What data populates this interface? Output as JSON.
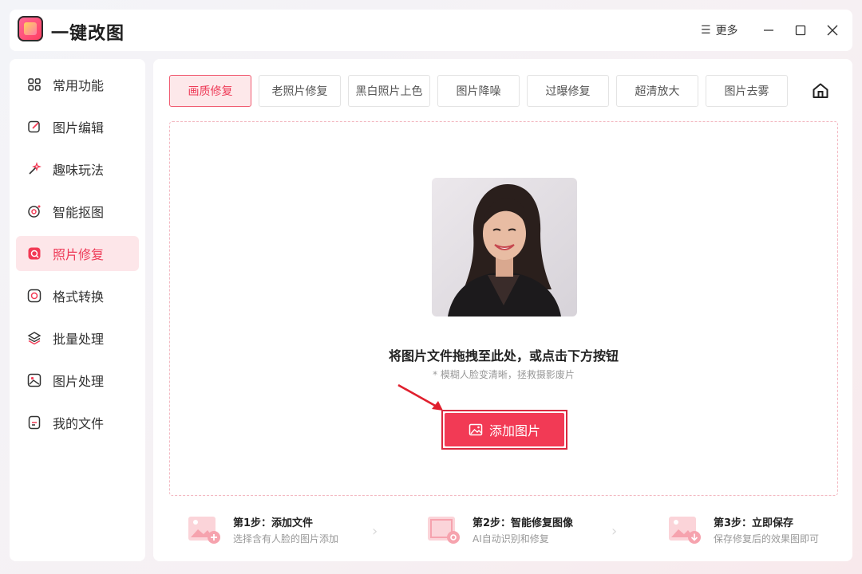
{
  "app": {
    "title": "一键改图"
  },
  "titlebar": {
    "more_label": "更多",
    "more_icon": "menu-icon",
    "minimize": "minimize-icon",
    "maximize": "maximize-icon",
    "close": "close-icon"
  },
  "sidebar": {
    "items": [
      {
        "label": "常用功能",
        "icon": "grid-icon",
        "active": false
      },
      {
        "label": "图片编辑",
        "icon": "edit-icon",
        "active": false
      },
      {
        "label": "趣味玩法",
        "icon": "magic-wand-icon",
        "active": false
      },
      {
        "label": "智能抠图",
        "icon": "cutout-icon",
        "active": false
      },
      {
        "label": "照片修复",
        "icon": "repair-icon",
        "active": true
      },
      {
        "label": "格式转换",
        "icon": "convert-icon",
        "active": false
      },
      {
        "label": "批量处理",
        "icon": "layers-icon",
        "active": false
      },
      {
        "label": "图片处理",
        "icon": "image-icon",
        "active": false
      },
      {
        "label": "我的文件",
        "icon": "file-icon",
        "active": false
      }
    ]
  },
  "tabs": [
    {
      "label": "画质修复",
      "active": true
    },
    {
      "label": "老照片修复",
      "active": false
    },
    {
      "label": "黑白照片上色",
      "active": false
    },
    {
      "label": "图片降噪",
      "active": false
    },
    {
      "label": "过曝修复",
      "active": false
    },
    {
      "label": "超清放大",
      "active": false
    },
    {
      "label": "图片去雾",
      "active": false
    }
  ],
  "dropzone": {
    "title": "将图片文件拖拽至此处，或点击下方按钮",
    "subtitle": "* 模糊人脸变清晰，拯救摄影废片",
    "button_label": "添加图片"
  },
  "steps": [
    {
      "title": "第1步：添加文件",
      "desc": "选择含有人脸的图片添加"
    },
    {
      "title": "第2步：智能修复图像",
      "desc": "AI自动识别和修复"
    },
    {
      "title": "第3步：立即保存",
      "desc": "保存修复后的效果图即可"
    }
  ],
  "colors": {
    "accent": "#f23a55",
    "accent_light": "#fde6e9"
  }
}
